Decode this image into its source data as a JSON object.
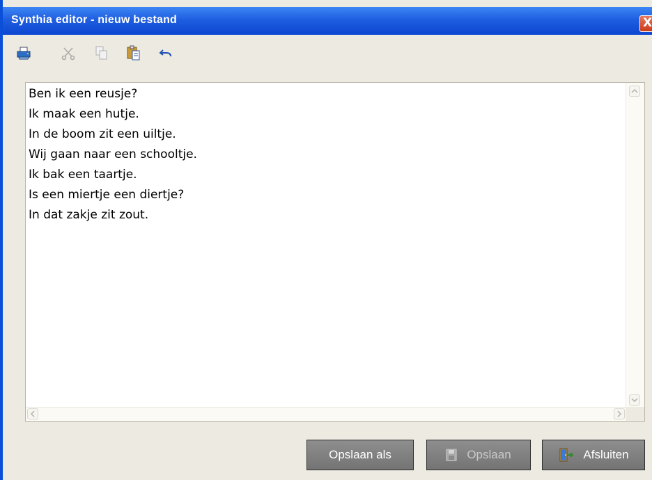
{
  "window": {
    "title": "Synthia editor - nieuw bestand",
    "close_label": "X"
  },
  "toolbar": {
    "buttons": [
      {
        "name": "print-icon",
        "enabled": true
      },
      {
        "name": "cut-icon",
        "enabled": false
      },
      {
        "name": "copy-icon",
        "enabled": false
      },
      {
        "name": "paste-icon",
        "enabled": true
      },
      {
        "name": "undo-icon",
        "enabled": true
      }
    ]
  },
  "editor": {
    "lines": [
      "Ben ik een reusje?",
      "Ik maak een hutje.",
      "In de boom zit een uiltje.",
      "Wij gaan naar een schooltje.",
      "Ik bak een taartje.",
      "Is een miertje een diertje?",
      "In dat zakje zit zout."
    ]
  },
  "buttons": {
    "save_as": "Opslaan als",
    "save": "Opslaan",
    "close": "Afsluiten"
  },
  "colors": {
    "titlebar": "#0b46d1",
    "window_bg": "#eceae1",
    "button_bg": "#7d7d7d"
  }
}
